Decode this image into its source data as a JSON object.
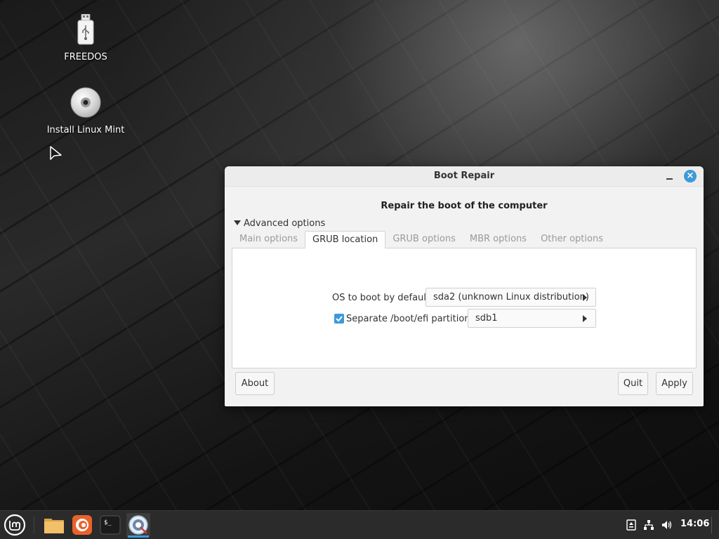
{
  "desktop": {
    "icons": [
      {
        "label": "FREEDOS",
        "icon": "usb-drive-icon"
      },
      {
        "label": "Install Linux Mint",
        "icon": "optical-disc-icon"
      }
    ]
  },
  "window": {
    "title": "Boot Repair",
    "heading": "Repair the boot of the computer",
    "advanced_toggle": "Advanced options",
    "tabs": [
      {
        "label": "Main options",
        "active": false
      },
      {
        "label": "GRUB location",
        "active": true
      },
      {
        "label": "GRUB options",
        "active": false
      },
      {
        "label": "MBR options",
        "active": false
      },
      {
        "label": "Other options",
        "active": false
      }
    ],
    "grub_location": {
      "os_label": "OS to boot by default:",
      "os_value": "sda2 (unknown Linux distribution)",
      "efi_checkbox_checked": true,
      "efi_label": "Separate /boot/efi partition:",
      "efi_value": "sdb1"
    },
    "buttons": {
      "about": "About",
      "quit": "Quit",
      "apply": "Apply"
    }
  },
  "taskbar": {
    "launchers": [
      "menu-icon",
      "files-icon",
      "firefox-icon",
      "terminal-icon",
      "boot-repair-icon"
    ],
    "tray": [
      "updates-icon",
      "network-icon",
      "volume-icon"
    ],
    "clock": "14:06"
  },
  "colors": {
    "accent": "#3d9ad8",
    "taskbar": "#2b2b2b",
    "window_bg": "#f2f2f2"
  }
}
